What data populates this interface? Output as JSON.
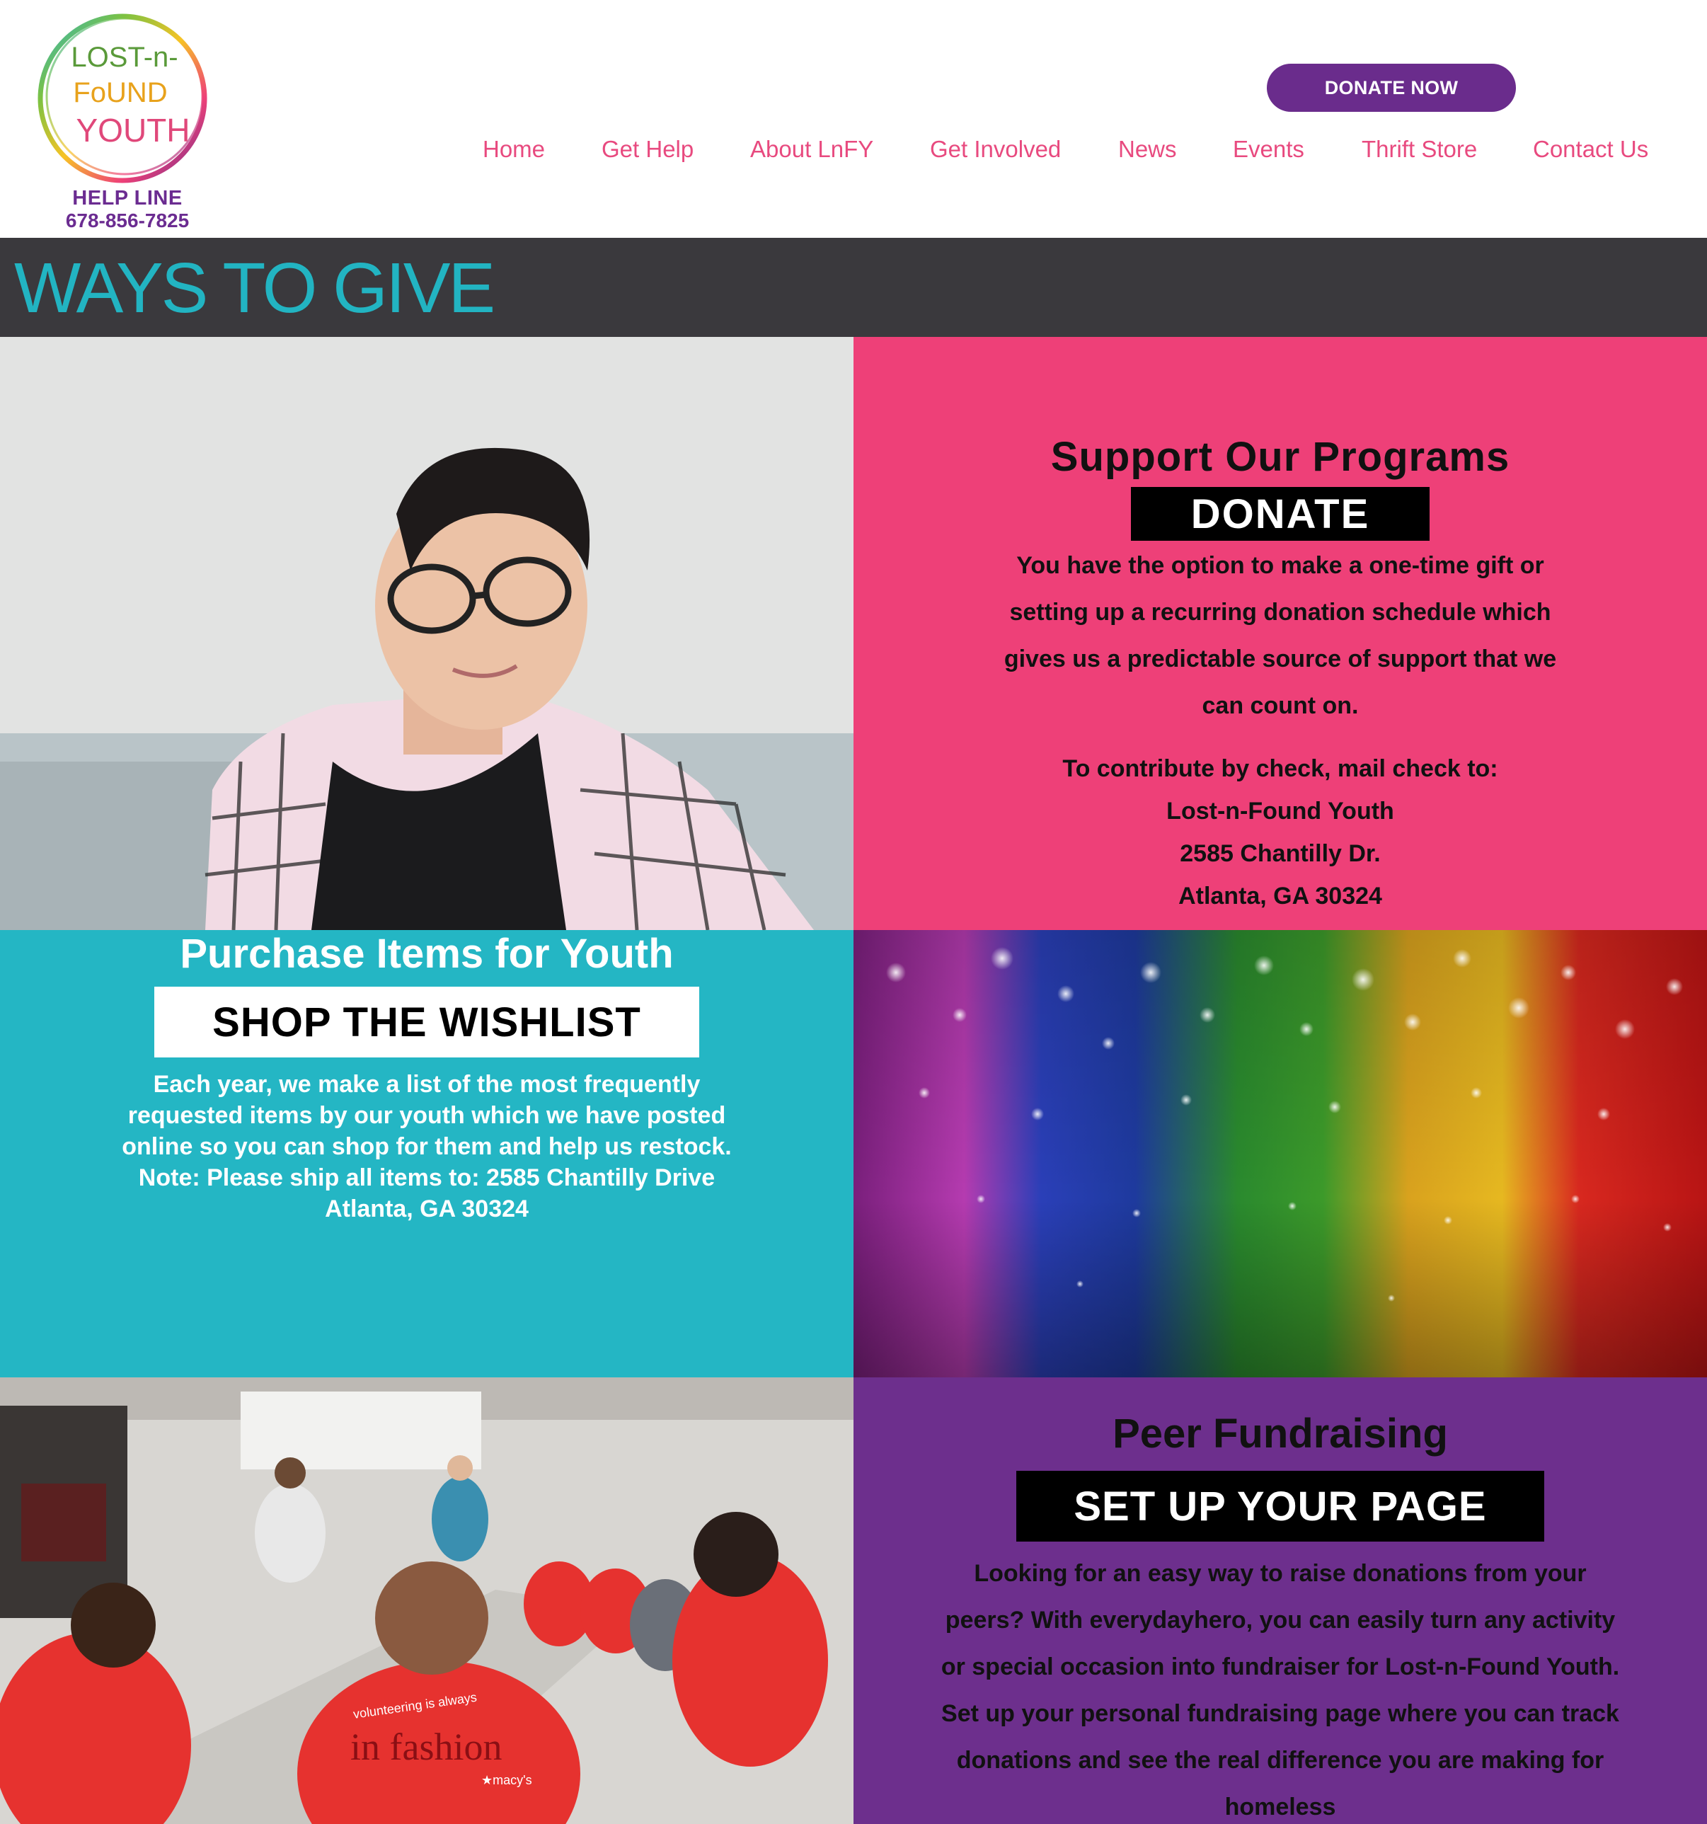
{
  "header": {
    "logo": {
      "line1": "LOST-n-",
      "line2": "FoUND",
      "line3": "YOUTH"
    },
    "helpline_label": "HELP LINE",
    "helpline_phone": "678-856-7825",
    "donate_now_label": "DONATE NOW",
    "nav": [
      "Home",
      "Get Help",
      "About LnFY",
      "Get Involved",
      "News",
      "Events",
      "Thrift Store",
      "Contact Us"
    ]
  },
  "title": "WAYS TO GIVE",
  "support": {
    "heading": "Support Our Programs",
    "button": "DONATE",
    "description": "You have the option to make a one-time gift or setting up a recurring donation schedule which gives us a predictable source of support that we can count on.",
    "check_lines": [
      "To contribute by check, mail check to:",
      "Lost-n-Found Youth",
      "2585 Chantilly Dr.",
      "Atlanta, GA 30324"
    ]
  },
  "wishlist": {
    "heading": "Purchase Items for Youth",
    "button": "SHOP THE WISHLIST",
    "description": "Each year, we make a list of the most frequently requested items by our youth which we have posted online so you can shop for them and help us restock. Note: Please ship all items to: 2585 Chantilly Drive Atlanta, GA 30324"
  },
  "fundraising": {
    "heading": "Peer Fundraising",
    "button": "SET UP YOUR PAGE",
    "description": "Looking for an easy way to raise donations from your peers? With everydayhero, you can easily turn any activity or special occasion into fundraiser for Lost-n-Found Youth. Set up your personal fundraising page where you can track donations and see the real difference you are making for homeless"
  },
  "photo2": {
    "shirt_line1": "volunteering is always",
    "shirt_line2": "in fashion",
    "shirt_brand": "★macy's"
  },
  "colors": {
    "pink": "#ee4078",
    "teal": "#24b6c4",
    "purple": "#6d2f8d",
    "dark_band": "#3a393d",
    "nav_pink": "#e84a7f"
  }
}
